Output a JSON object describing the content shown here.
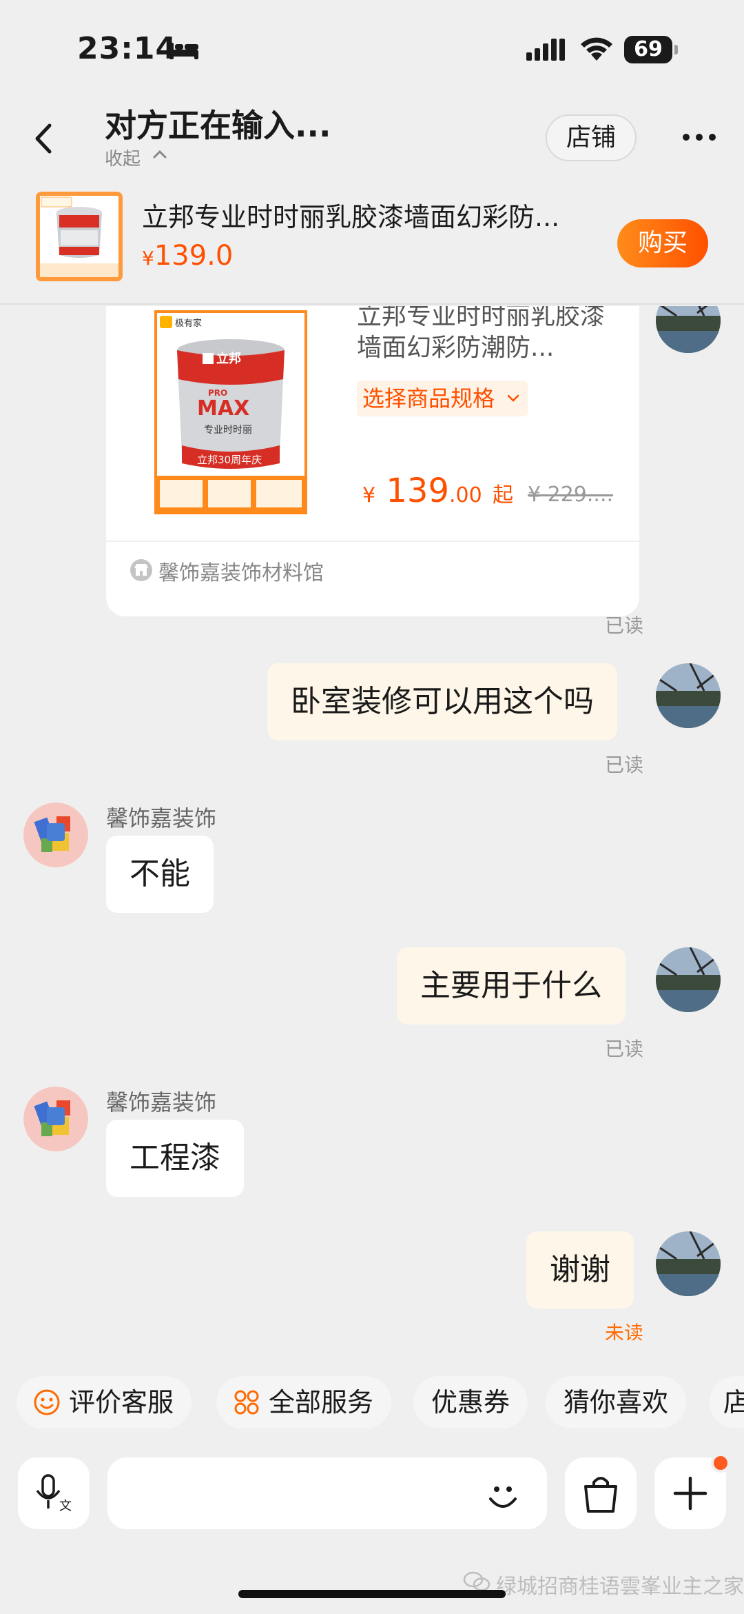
{
  "status_bar": {
    "time": "23:14",
    "battery": "69"
  },
  "nav": {
    "title": "对方正在输入...",
    "subtitle": "收起",
    "store_button": "店铺"
  },
  "product_bar": {
    "title": "立邦专业时时丽乳胶漆墙面幻彩防...",
    "currency": "¥",
    "price": "139.0",
    "buy_button": "购买"
  },
  "product_card": {
    "title": "立邦专业时时丽乳胶漆墙面幻彩防潮防...",
    "spec_label": "选择商品规格",
    "currency": "¥",
    "price_int": "139",
    "price_dec": ".00",
    "price_suffix": "起",
    "original_price": "¥ 229....",
    "shop_name": "馨饰嘉装饰材料馆",
    "image_text": {
      "brand": "极有家",
      "logo": "立邦",
      "pro": "PRO",
      "max": "MAX",
      "product": "专业时时丽",
      "anniv": "立邦30周年庆"
    }
  },
  "messages": [
    {
      "from": "me",
      "text": "卧室装修可以用这个吗",
      "status": "已读"
    },
    {
      "from": "them",
      "sender": "馨饰嘉装饰",
      "text": "不能"
    },
    {
      "from": "me",
      "text": "主要用于什么",
      "status": "已读"
    },
    {
      "from": "them",
      "sender": "馨饰嘉装饰",
      "text": "工程漆"
    },
    {
      "from": "me",
      "text": "谢谢",
      "status": "未读"
    }
  ],
  "card_status": "已读",
  "quick_actions": [
    "评价客服",
    "全部服务",
    "优惠券",
    "猜你喜欢",
    "店"
  ],
  "input": {
    "placeholder": ""
  },
  "watermark": "绿城招商桂语雲峯业主之家",
  "colors": {
    "accent": "#ff5000",
    "my_bubble": "#fdf6e9",
    "background": "#efefef"
  }
}
